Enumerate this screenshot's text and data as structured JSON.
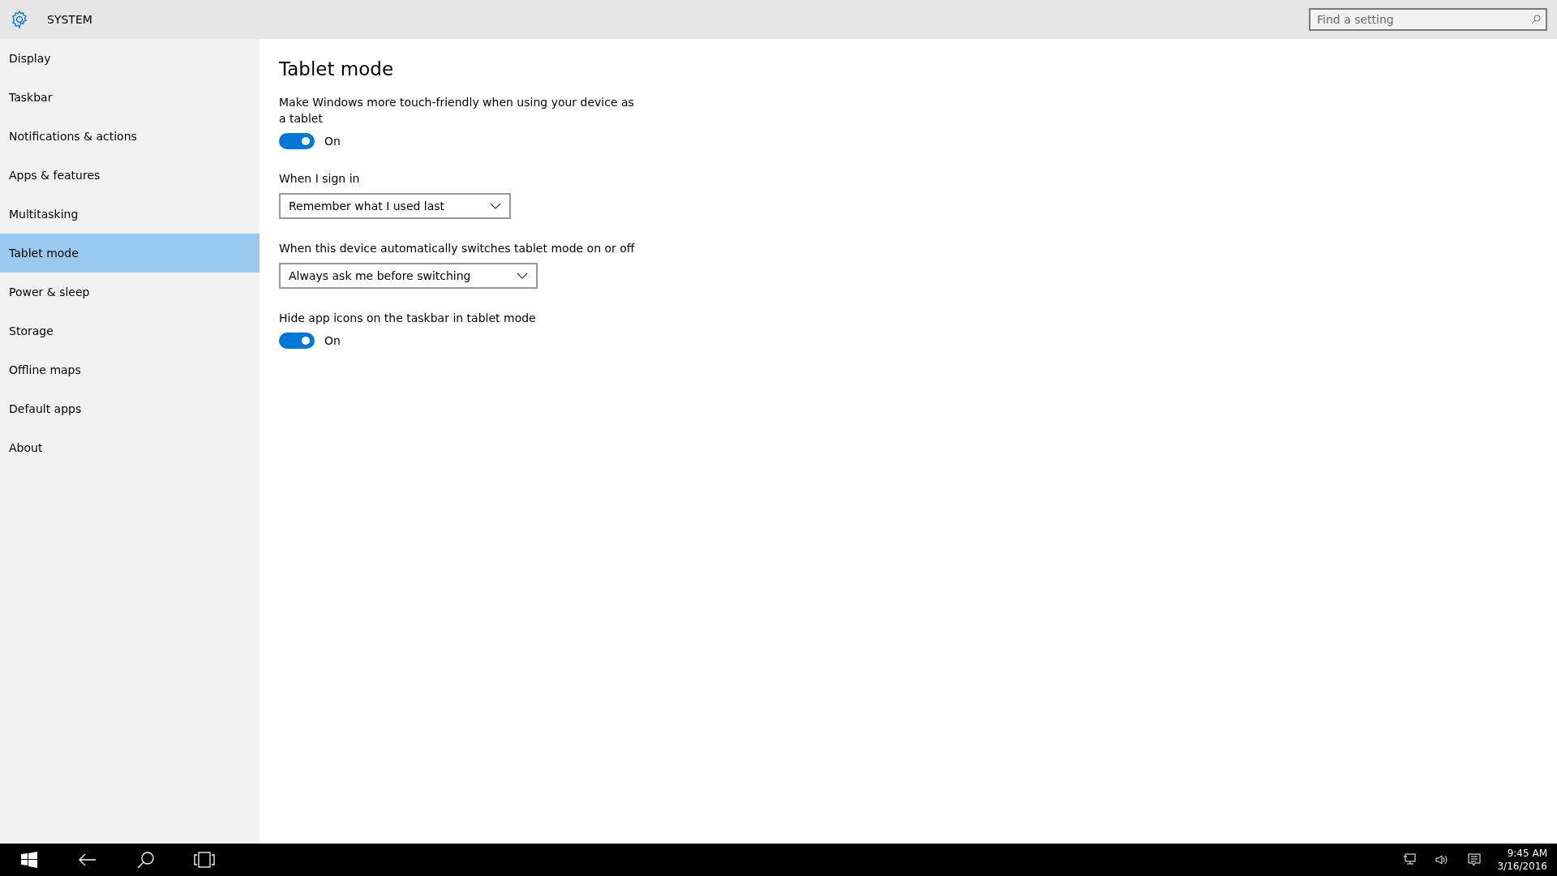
{
  "header": {
    "title": "SYSTEM",
    "search": {
      "placeholder": "Find a setting"
    }
  },
  "sidebar": {
    "items": [
      {
        "label": "Display",
        "selected": false
      },
      {
        "label": "Taskbar",
        "selected": false
      },
      {
        "label": "Notifications & actions",
        "selected": false
      },
      {
        "label": "Apps & features",
        "selected": false
      },
      {
        "label": "Multitasking",
        "selected": false
      },
      {
        "label": "Tablet mode",
        "selected": true
      },
      {
        "label": "Power & sleep",
        "selected": false
      },
      {
        "label": "Storage",
        "selected": false
      },
      {
        "label": "Offline maps",
        "selected": false
      },
      {
        "label": "Default apps",
        "selected": false
      },
      {
        "label": "About",
        "selected": false
      }
    ]
  },
  "content": {
    "title": "Tablet mode",
    "settings": [
      {
        "kind": "toggle",
        "label": "Make Windows more touch-friendly when using your device as a tablet",
        "on": true,
        "state_text": "On"
      },
      {
        "kind": "dropdown",
        "label": "When I sign in",
        "value": "Remember what I used last"
      },
      {
        "kind": "dropdown",
        "label": "When this device automatically switches tablet mode on or off",
        "value": "Always ask me before switching"
      },
      {
        "kind": "toggle",
        "label": "Hide app icons on the taskbar in tablet mode",
        "on": true,
        "state_text": "On"
      }
    ]
  },
  "taskbar": {
    "time": "9:45 AM",
    "date": "3/16/2016"
  }
}
